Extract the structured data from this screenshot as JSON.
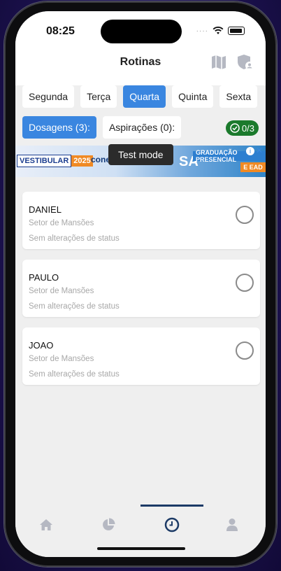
{
  "status_bar": {
    "time": "08:25",
    "signal_dots": "····"
  },
  "header": {
    "title": "Rotinas",
    "icons": [
      "map-icon",
      "shield-user-icon"
    ]
  },
  "days": [
    {
      "label": "Segunda",
      "active": false
    },
    {
      "label": "Terça",
      "active": false
    },
    {
      "label": "Quarta",
      "active": true
    },
    {
      "label": "Quinta",
      "active": false
    },
    {
      "label": "Sexta",
      "active": false
    }
  ],
  "types": [
    {
      "label": "Dosagens (3):",
      "active": true
    },
    {
      "label": "Aspirações (0):",
      "active": false
    }
  ],
  "progress": {
    "label": "0/3",
    "color": "#1b7a2c"
  },
  "ad": {
    "left_tag": "VESTIBULAR",
    "year": "2025",
    "middle_text": "conect",
    "brand": "SA",
    "grad_text": "GRADUAÇÃO PRESENCIAL",
    "ead_text": "E EAD",
    "info_glyph": "i",
    "close_glyph": "✕"
  },
  "test_mode": {
    "label": "Test mode"
  },
  "patients": [
    {
      "name": "DANIEL",
      "sector": "Setor de Mansões",
      "status": "Sem alterações de status"
    },
    {
      "name": "PAULO",
      "sector": "Setor de Mansões",
      "status": "Sem alterações de status"
    },
    {
      "name": "JOAO",
      "sector": "Setor de Mansões",
      "status": "Sem alterações de status"
    }
  ],
  "tabs": [
    {
      "icon": "home-icon",
      "active": false
    },
    {
      "icon": "pie-chart-icon",
      "active": false
    },
    {
      "icon": "clock-icon",
      "active": true
    },
    {
      "icon": "user-icon",
      "active": false
    }
  ],
  "colors": {
    "accent": "#3a86e0",
    "active_tab": "#1c3a66",
    "inactive_tab": "#b5b8c2"
  }
}
